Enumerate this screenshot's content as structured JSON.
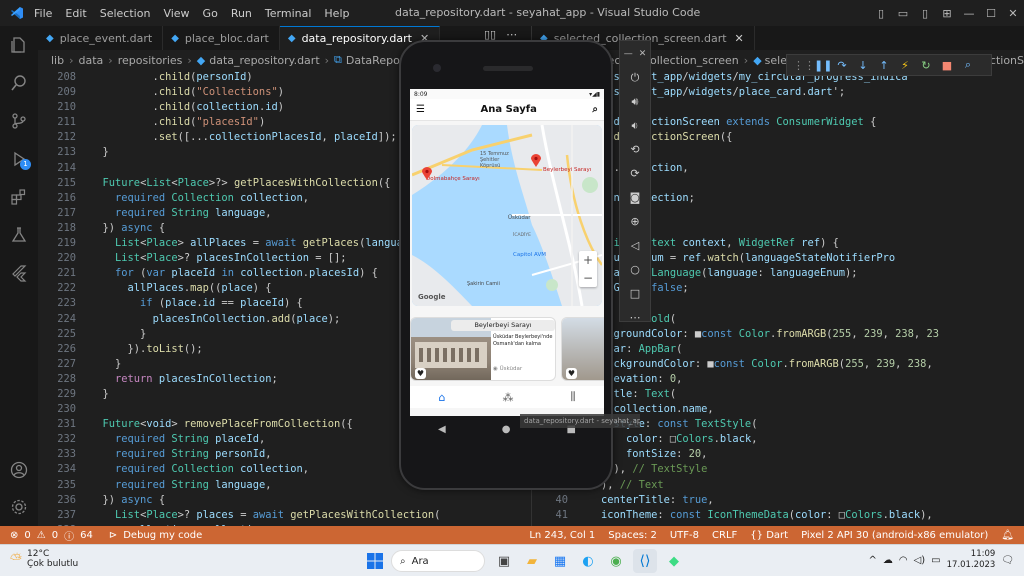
{
  "app": {
    "window_title": "data_repository.dart - seyahat_app - Visual Studio Code",
    "menu": [
      "File",
      "Edit",
      "Selection",
      "View",
      "Go",
      "Run",
      "Terminal",
      "Help"
    ]
  },
  "colors": {
    "accent": "#0078d4",
    "status_bar": "#cc6633",
    "keyword": "#569cd6",
    "control": "#c586c0",
    "type": "#4ec9b0",
    "string": "#ce9178",
    "function": "#dcdcaa",
    "variable": "#9cdcfe",
    "number": "#b5cea8",
    "comment": "#6a9955"
  },
  "activity_icons": [
    "files-icon",
    "search-icon",
    "source-control-icon",
    "run-debug-icon",
    "extensions-icon",
    "testing-icon",
    "flutter-icon",
    "account-icon",
    "settings-gear-icon"
  ],
  "run_debug_badge": "1",
  "tabs_left": [
    {
      "label": "place_event.dart",
      "active": false
    },
    {
      "label": "place_bloc.dart",
      "active": false
    },
    {
      "label": "data_repository.dart",
      "active": true
    }
  ],
  "tabs_right": [
    {
      "label": "selected_collection_screen.dart",
      "active": false
    }
  ],
  "breadcrumb_left": [
    "lib",
    "data",
    "repositories",
    "data_repository.dart",
    "DataRepository"
  ],
  "breadcrumb_right": [
    "selected_collection_screen",
    "sele"
  ],
  "breadcrumb_right_tail": "dCollectionS",
  "editor_left": {
    "lines": [
      {
        "n": "208",
        "text": "          .child(personId)"
      },
      {
        "n": "209",
        "text": "          .child(\"Collections\")"
      },
      {
        "n": "210",
        "text": "          .child(collection.id)"
      },
      {
        "n": "211",
        "text": "          .child(\"placesId\")"
      },
      {
        "n": "212",
        "text": "          .set([...collectionPlacesId, placeId]);"
      },
      {
        "n": "213",
        "text": "  }"
      },
      {
        "n": "214",
        "text": ""
      },
      {
        "n": "215",
        "text": "  Future<List<Place>?> getPlacesWithCollection({"
      },
      {
        "n": "216",
        "text": "    required Collection collection,"
      },
      {
        "n": "217",
        "text": "    required String language,"
      },
      {
        "n": "218",
        "text": "  }) async {"
      },
      {
        "n": "219",
        "text": "    List<Place> allPlaces = await getPlaces(langua"
      },
      {
        "n": "220",
        "text": "    List<Place>? placesInCollection = [];"
      },
      {
        "n": "221",
        "text": "    for (var placeId in collection.placesId) {"
      },
      {
        "n": "222",
        "text": "      allPlaces.map((place) {"
      },
      {
        "n": "223",
        "text": "        if (place.id == placeId) {"
      },
      {
        "n": "224",
        "text": "          placesInCollection.add(place);"
      },
      {
        "n": "225",
        "text": "        }"
      },
      {
        "n": "226",
        "text": "      }).toList();"
      },
      {
        "n": "227",
        "text": "    }"
      },
      {
        "n": "228",
        "text": "    return placesInCollection;"
      },
      {
        "n": "229",
        "text": "  }"
      },
      {
        "n": "230",
        "text": ""
      },
      {
        "n": "231",
        "text": "  Future<void> removePlaceFromCollection({"
      },
      {
        "n": "232",
        "text": "    required String placeId,"
      },
      {
        "n": "233",
        "text": "    required String personId,"
      },
      {
        "n": "234",
        "text": "    required Collection collection,"
      },
      {
        "n": "235",
        "text": "    required String language,"
      },
      {
        "n": "236",
        "text": "  }) async {"
      },
      {
        "n": "237",
        "text": "    List<Place>? places = await getPlacesWithCollection("
      },
      {
        "n": "238",
        "text": "      collection: collection,"
      }
    ]
  },
  "editor_right": {
    "lines": [
      {
        "n": "",
        "text": "ckage:seyahat_app/widgets/my_circular_progress_indica"
      },
      {
        "n": "",
        "text": "ckage:seyahat_app/widgets/place_card.dart';"
      },
      {
        "n": "",
        "text": ""
      },
      {
        "n": "",
        "text": "electedCollectionScreen extends ConsumerWidget {"
      },
      {
        "n": "",
        "text": "electedCollectionScreen({"
      },
      {
        "n": "",
        "text": "y,"
      },
      {
        "n": "",
        "text": "d this.collection,"
      },
      {
        "n": "",
        "text": "r(key: key);"
      },
      {
        "n": "",
        "text": "lection collection;"
      },
      {
        "n": "",
        "text": ""
      },
      {
        "n": "",
        "text": ""
      },
      {
        "n": "",
        "text": "ild(BuildContext context, WidgetRef ref) {"
      },
      {
        "n": "",
        "text": "s languageEnum = ref.watch(languageStateNotifierPro"
      },
      {
        "n": "",
        "text": " language = Language(language: languageEnum);"
      },
      {
        "n": "",
        "text": "PlacesGet = false;"
      },
      {
        "n": "",
        "text": ""
      },
      {
        "n": "",
        "text": "return Scaffold("
      },
      {
        "n": "",
        "text": "  backgroundColor: ■const Color.fromARGB(255, 239, 238, 23"
      },
      {
        "n": "",
        "text": "  appBar: AppBar("
      },
      {
        "n": "",
        "text": "    backgroundColor: ■const Color.fromARGB(255, 239, 238,"
      },
      {
        "n": "",
        "text": "    elevation: 0,"
      },
      {
        "n": "",
        "text": "    title: Text("
      },
      {
        "n": "",
        "text": "      collection.name,"
      },
      {
        "n": "",
        "text": "      style: const TextStyle("
      },
      {
        "n": "",
        "text": "        color: □Colors.black,"
      },
      {
        "n": "",
        "text": "        fontSize: 20,"
      },
      {
        "n": "",
        "text": "      ), // TextStyle"
      },
      {
        "n": "39",
        "text": "    ), // Text"
      },
      {
        "n": "40",
        "text": "    centerTitle: true,"
      },
      {
        "n": "41",
        "text": "    iconTheme: const IconThemeData(color: □Colors.black),"
      }
    ]
  },
  "status": {
    "errors": "0",
    "warnings": "0",
    "info": "64",
    "debug": "Debug my code",
    "position": "Ln 243, Col 1",
    "spaces": "Spaces: 2",
    "encoding": "UTF-8",
    "eol": "CRLF",
    "language": "Dart",
    "device": "Pixel 2 API 30 (android-x86 emulator)"
  },
  "phone": {
    "time": "8:09",
    "app_title": "Ana Sayfa",
    "map_labels": {
      "bridge": "15 Temmuz Şehitler Köprüsü",
      "dolmabahce": "Dolmabahçe Sarayı",
      "beylerbeyi": "Beylerbeyi Sarayı",
      "uskudar": "Üsküdar",
      "icadiye": "İCADİYE",
      "capitol": "Capitol AVM",
      "sakirin": "Şakirin Camii",
      "google": "Google"
    },
    "card": {
      "title": "Beylerbeyi Sarayı",
      "desc": "Üsküdar Beylerbeyi'nde Osmanlı'dan kalma",
      "location": "Üsküdar"
    },
    "zoom_in": "+",
    "zoom_out": "−"
  },
  "tooltip": "data_repository.dart - seyahat_app - Visual Studio Code",
  "taskbar": {
    "temp": "12°C",
    "weather": "Çok bulutlu",
    "search": "Ara",
    "time": "11:09",
    "date": "17.01.2023"
  }
}
